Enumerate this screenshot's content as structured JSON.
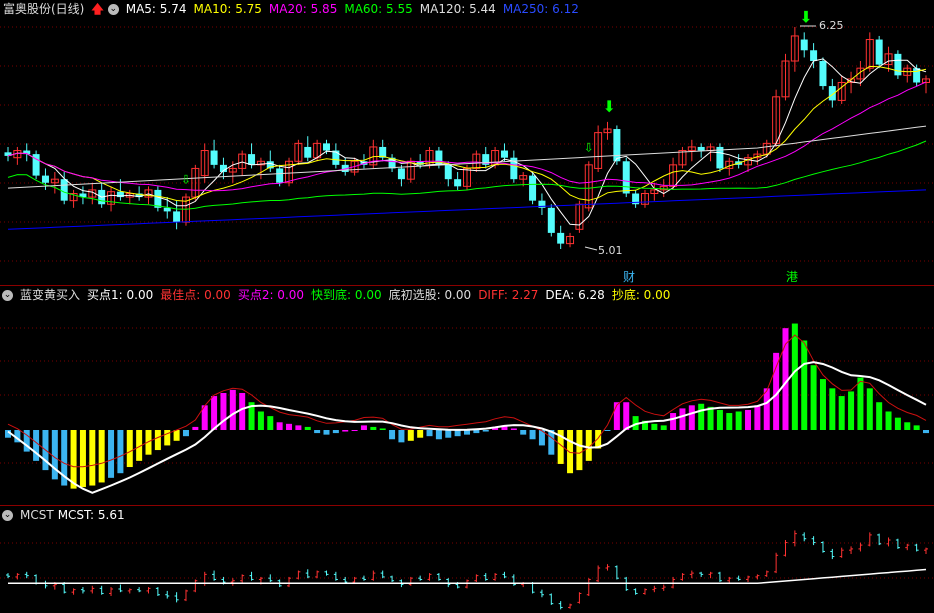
{
  "top_bar": {
    "title": "富奥股份(日线)",
    "ma5": "MA5: 5.74",
    "ma10": "MA10: 5.75",
    "ma20": "MA20: 5.85",
    "ma60": "MA60: 5.55",
    "ma120": "MA120: 5.44",
    "ma250": "MA250: 6.12"
  },
  "price_panel": {
    "high_label": "6.25",
    "low_label": "5.01",
    "marker_cai": "财",
    "marker_gang": "港"
  },
  "indicator_bar": {
    "name": "蓝变黄买入",
    "buy1": "买点1: 0.00",
    "best": "最佳点: 0.00",
    "buy2": "买点2: 0.00",
    "fast_bottom": "快到底: 0.00",
    "bottom_select": "底初选股: 0.00",
    "diff": "DIFF: 2.27",
    "dea": "DEA: 6.28",
    "chaodi": "抄底: 0.00"
  },
  "mcst_bar": {
    "name": "MCST",
    "value": "MCST: 5.61"
  },
  "colors": {
    "ma5": "#ffffff",
    "ma10": "#ffff00",
    "ma20": "#ff00ff",
    "ma60": "#00ff00",
    "ma120": "#dddddd",
    "ma250": "#0000ff",
    "up": "#ff3232",
    "down": "#54fcfc",
    "hist_blue": "#3cb4f0",
    "hist_yellow": "#ffff00",
    "hist_magenta": "#ff00ff",
    "hist_green": "#00ff00"
  },
  "chart_data": {
    "type": "candlestick",
    "candles": [
      {
        "o": 5.55,
        "h": 5.58,
        "l": 5.5,
        "c": 5.53
      },
      {
        "o": 5.52,
        "h": 5.58,
        "l": 5.48,
        "c": 5.56
      },
      {
        "o": 5.56,
        "h": 5.6,
        "l": 5.5,
        "c": 5.54
      },
      {
        "o": 5.54,
        "h": 5.56,
        "l": 5.4,
        "c": 5.42
      },
      {
        "o": 5.42,
        "h": 5.46,
        "l": 5.34,
        "c": 5.38
      },
      {
        "o": 5.38,
        "h": 5.44,
        "l": 5.32,
        "c": 5.4
      },
      {
        "o": 5.4,
        "h": 5.44,
        "l": 5.26,
        "c": 5.28
      },
      {
        "o": 5.28,
        "h": 5.34,
        "l": 5.24,
        "c": 5.32
      },
      {
        "o": 5.32,
        "h": 5.36,
        "l": 5.26,
        "c": 5.3
      },
      {
        "o": 5.3,
        "h": 5.38,
        "l": 5.26,
        "c": 5.34
      },
      {
        "o": 5.34,
        "h": 5.38,
        "l": 5.24,
        "c": 5.26
      },
      {
        "o": 5.26,
        "h": 5.36,
        "l": 5.22,
        "c": 5.33
      },
      {
        "o": 5.33,
        "h": 5.4,
        "l": 5.28,
        "c": 5.3
      },
      {
        "o": 5.3,
        "h": 5.34,
        "l": 5.26,
        "c": 5.32
      },
      {
        "o": 5.32,
        "h": 5.36,
        "l": 5.28,
        "c": 5.3
      },
      {
        "o": 5.3,
        "h": 5.36,
        "l": 5.26,
        "c": 5.34
      },
      {
        "o": 5.34,
        "h": 5.36,
        "l": 5.22,
        "c": 5.24
      },
      {
        "o": 5.24,
        "h": 5.3,
        "l": 5.18,
        "c": 5.22
      },
      {
        "o": 5.22,
        "h": 5.28,
        "l": 5.12,
        "c": 5.16
      },
      {
        "o": 5.16,
        "h": 5.32,
        "l": 5.14,
        "c": 5.3
      },
      {
        "o": 5.3,
        "h": 5.48,
        "l": 5.28,
        "c": 5.46
      },
      {
        "o": 5.42,
        "h": 5.6,
        "l": 5.38,
        "c": 5.56
      },
      {
        "o": 5.56,
        "h": 5.62,
        "l": 5.46,
        "c": 5.48
      },
      {
        "o": 5.48,
        "h": 5.52,
        "l": 5.4,
        "c": 5.44
      },
      {
        "o": 5.44,
        "h": 5.5,
        "l": 5.38,
        "c": 5.46
      },
      {
        "o": 5.46,
        "h": 5.56,
        "l": 5.42,
        "c": 5.54
      },
      {
        "o": 5.54,
        "h": 5.6,
        "l": 5.46,
        "c": 5.48
      },
      {
        "o": 5.48,
        "h": 5.52,
        "l": 5.4,
        "c": 5.5
      },
      {
        "o": 5.5,
        "h": 5.56,
        "l": 5.44,
        "c": 5.46
      },
      {
        "o": 5.46,
        "h": 5.48,
        "l": 5.36,
        "c": 5.38
      },
      {
        "o": 5.38,
        "h": 5.52,
        "l": 5.36,
        "c": 5.5
      },
      {
        "o": 5.5,
        "h": 5.62,
        "l": 5.48,
        "c": 5.6
      },
      {
        "o": 5.58,
        "h": 5.64,
        "l": 5.5,
        "c": 5.52
      },
      {
        "o": 5.52,
        "h": 5.62,
        "l": 5.5,
        "c": 5.6
      },
      {
        "o": 5.6,
        "h": 5.62,
        "l": 5.54,
        "c": 5.56
      },
      {
        "o": 5.56,
        "h": 5.6,
        "l": 5.46,
        "c": 5.48
      },
      {
        "o": 5.48,
        "h": 5.52,
        "l": 5.42,
        "c": 5.44
      },
      {
        "o": 5.44,
        "h": 5.52,
        "l": 5.42,
        "c": 5.5
      },
      {
        "o": 5.5,
        "h": 5.54,
        "l": 5.46,
        "c": 5.48
      },
      {
        "o": 5.48,
        "h": 5.62,
        "l": 5.46,
        "c": 5.58
      },
      {
        "o": 5.58,
        "h": 5.62,
        "l": 5.5,
        "c": 5.52
      },
      {
        "o": 5.52,
        "h": 5.54,
        "l": 5.44,
        "c": 5.46
      },
      {
        "o": 5.46,
        "h": 5.48,
        "l": 5.36,
        "c": 5.4
      },
      {
        "o": 5.4,
        "h": 5.52,
        "l": 5.38,
        "c": 5.5
      },
      {
        "o": 5.5,
        "h": 5.54,
        "l": 5.46,
        "c": 5.48
      },
      {
        "o": 5.48,
        "h": 5.58,
        "l": 5.46,
        "c": 5.56
      },
      {
        "o": 5.56,
        "h": 5.58,
        "l": 5.46,
        "c": 5.48
      },
      {
        "o": 5.48,
        "h": 5.5,
        "l": 5.36,
        "c": 5.4
      },
      {
        "o": 5.4,
        "h": 5.44,
        "l": 5.34,
        "c": 5.36
      },
      {
        "o": 5.36,
        "h": 5.48,
        "l": 5.34,
        "c": 5.46
      },
      {
        "o": 5.46,
        "h": 5.56,
        "l": 5.44,
        "c": 5.54
      },
      {
        "o": 5.54,
        "h": 5.58,
        "l": 5.46,
        "c": 5.48
      },
      {
        "o": 5.48,
        "h": 5.58,
        "l": 5.46,
        "c": 5.56
      },
      {
        "o": 5.56,
        "h": 5.6,
        "l": 5.5,
        "c": 5.52
      },
      {
        "o": 5.52,
        "h": 5.56,
        "l": 5.38,
        "c": 5.4
      },
      {
        "o": 5.4,
        "h": 5.44,
        "l": 5.36,
        "c": 5.42
      },
      {
        "o": 5.42,
        "h": 5.44,
        "l": 5.26,
        "c": 5.28
      },
      {
        "o": 5.28,
        "h": 5.32,
        "l": 5.2,
        "c": 5.24
      },
      {
        "o": 5.24,
        "h": 5.26,
        "l": 5.08,
        "c": 5.1
      },
      {
        "o": 5.1,
        "h": 5.14,
        "l": 5.01,
        "c": 5.04
      },
      {
        "o": 5.04,
        "h": 5.1,
        "l": 5.02,
        "c": 5.08
      },
      {
        "o": 5.12,
        "h": 5.28,
        "l": 5.1,
        "c": 5.26
      },
      {
        "o": 5.24,
        "h": 5.5,
        "l": 5.22,
        "c": 5.48
      },
      {
        "o": 5.46,
        "h": 5.7,
        "l": 5.44,
        "c": 5.66
      },
      {
        "o": 5.66,
        "h": 5.72,
        "l": 5.62,
        "c": 5.68
      },
      {
        "o": 5.68,
        "h": 5.7,
        "l": 5.48,
        "c": 5.5
      },
      {
        "o": 5.5,
        "h": 5.52,
        "l": 5.3,
        "c": 5.32
      },
      {
        "o": 5.32,
        "h": 5.34,
        "l": 5.24,
        "c": 5.26
      },
      {
        "o": 5.26,
        "h": 5.34,
        "l": 5.24,
        "c": 5.32
      },
      {
        "o": 5.32,
        "h": 5.38,
        "l": 5.28,
        "c": 5.34
      },
      {
        "o": 5.34,
        "h": 5.4,
        "l": 5.3,
        "c": 5.36
      },
      {
        "o": 5.36,
        "h": 5.52,
        "l": 5.34,
        "c": 5.48
      },
      {
        "o": 5.48,
        "h": 5.58,
        "l": 5.46,
        "c": 5.56
      },
      {
        "o": 5.56,
        "h": 5.62,
        "l": 5.5,
        "c": 5.58
      },
      {
        "o": 5.58,
        "h": 5.6,
        "l": 5.52,
        "c": 5.56
      },
      {
        "o": 5.56,
        "h": 5.6,
        "l": 5.5,
        "c": 5.58
      },
      {
        "o": 5.58,
        "h": 5.6,
        "l": 5.44,
        "c": 5.46
      },
      {
        "o": 5.46,
        "h": 5.52,
        "l": 5.42,
        "c": 5.5
      },
      {
        "o": 5.5,
        "h": 5.54,
        "l": 5.46,
        "c": 5.48
      },
      {
        "o": 5.48,
        "h": 5.54,
        "l": 5.44,
        "c": 5.52
      },
      {
        "o": 5.52,
        "h": 5.56,
        "l": 5.48,
        "c": 5.54
      },
      {
        "o": 5.54,
        "h": 5.62,
        "l": 5.52,
        "c": 5.6
      },
      {
        "o": 5.6,
        "h": 5.9,
        "l": 5.58,
        "c": 5.86
      },
      {
        "o": 5.86,
        "h": 6.1,
        "l": 5.84,
        "c": 6.06
      },
      {
        "o": 6.06,
        "h": 6.25,
        "l": 6.0,
        "c": 6.2
      },
      {
        "o": 6.18,
        "h": 6.22,
        "l": 6.08,
        "c": 6.12
      },
      {
        "o": 6.12,
        "h": 6.16,
        "l": 6.02,
        "c": 6.06
      },
      {
        "o": 6.06,
        "h": 6.08,
        "l": 5.9,
        "c": 5.92
      },
      {
        "o": 5.92,
        "h": 5.96,
        "l": 5.8,
        "c": 5.84
      },
      {
        "o": 5.84,
        "h": 5.98,
        "l": 5.82,
        "c": 5.94
      },
      {
        "o": 5.94,
        "h": 6.0,
        "l": 5.88,
        "c": 5.96
      },
      {
        "o": 5.96,
        "h": 6.06,
        "l": 5.92,
        "c": 6.02
      },
      {
        "o": 6.02,
        "h": 6.22,
        "l": 6.0,
        "c": 6.18
      },
      {
        "o": 6.18,
        "h": 6.2,
        "l": 6.02,
        "c": 6.04
      },
      {
        "o": 6.04,
        "h": 6.14,
        "l": 6.0,
        "c": 6.1
      },
      {
        "o": 6.1,
        "h": 6.12,
        "l": 5.96,
        "c": 5.98
      },
      {
        "o": 5.98,
        "h": 6.04,
        "l": 5.94,
        "c": 6.02
      },
      {
        "o": 6.02,
        "h": 6.04,
        "l": 5.92,
        "c": 5.94
      },
      {
        "o": 5.94,
        "h": 5.98,
        "l": 5.88,
        "c": 5.96
      }
    ],
    "ma250_start": 5.12,
    "ma250_end": 5.34,
    "macd_hist": [
      -0.5,
      -0.8,
      -1.4,
      -2.0,
      -2.6,
      -3.2,
      -3.6,
      -3.8,
      -3.7,
      -3.6,
      -3.4,
      -3.1,
      -2.8,
      -2.4,
      -2.0,
      -1.6,
      -1.3,
      -1.0,
      -0.7,
      -0.4,
      0.2,
      1.6,
      2.2,
      2.4,
      2.6,
      2.4,
      1.8,
      1.2,
      0.9,
      0.5,
      0.4,
      0.3,
      0.2,
      -0.2,
      -0.3,
      -0.2,
      -0.1,
      0.0,
      0.3,
      0.2,
      0.1,
      -0.6,
      -0.8,
      -0.7,
      -0.5,
      -0.4,
      -0.6,
      -0.5,
      -0.4,
      -0.3,
      -0.2,
      -0.1,
      0.2,
      0.3,
      0.1,
      -0.3,
      -0.6,
      -1.0,
      -1.6,
      -2.2,
      -2.8,
      -2.6,
      -2.0,
      -1.2,
      0.0,
      1.8,
      1.8,
      0.9,
      0.6,
      0.4,
      0.3,
      1.1,
      1.4,
      1.6,
      1.7,
      1.5,
      1.3,
      1.1,
      1.2,
      1.3,
      1.6,
      2.7,
      5.0,
      6.6,
      6.9,
      5.8,
      4.2,
      3.3,
      2.7,
      2.2,
      2.5,
      3.4,
      2.7,
      1.8,
      1.2,
      0.8,
      0.5,
      0.3,
      -0.2
    ],
    "macd_color": [
      "b",
      "b",
      "b",
      "b",
      "b",
      "b",
      "b",
      "y",
      "y",
      "y",
      "y",
      "b",
      "b",
      "y",
      "y",
      "y",
      "y",
      "y",
      "y",
      "b",
      "m",
      "m",
      "m",
      "m",
      "m",
      "m",
      "g",
      "g",
      "g",
      "m",
      "m",
      "m",
      "g",
      "b",
      "b",
      "b",
      "m",
      "m",
      "m",
      "g",
      "g",
      "b",
      "b",
      "y",
      "y",
      "b",
      "b",
      "b",
      "b",
      "b",
      "b",
      "b",
      "m",
      "m",
      "m",
      "b",
      "b",
      "b",
      "b",
      "y",
      "y",
      "y",
      "y",
      "y",
      "b",
      "m",
      "m",
      "g",
      "g",
      "g",
      "g",
      "m",
      "m",
      "m",
      "g",
      "g",
      "g",
      "g",
      "g",
      "m",
      "m",
      "m",
      "m",
      "m",
      "g",
      "g",
      "g",
      "g",
      "g",
      "g",
      "g",
      "g",
      "g",
      "g",
      "g",
      "g",
      "g",
      "g",
      "b"
    ]
  }
}
